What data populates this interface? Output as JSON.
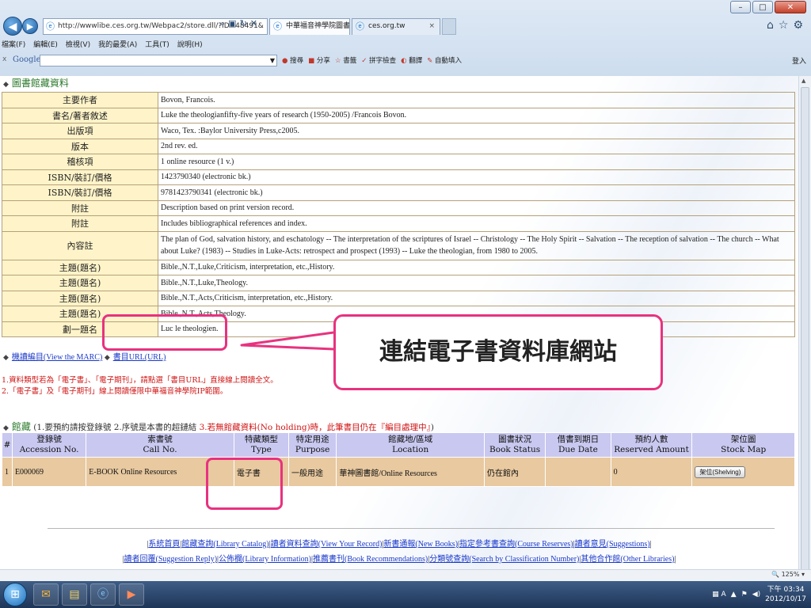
{
  "browser": {
    "address": "http://wwwlibe.ces.org.tw/Webpac2/store.dll/?ID=48491&",
    "tabs": [
      {
        "title": "中華福音神學院圖書館"
      },
      {
        "title": "ces.org.tw"
      }
    ],
    "menu": [
      "檔案(F)",
      "編輯(E)",
      "檢視(V)",
      "我的最愛(A)",
      "工具(T)",
      "說明(H)"
    ],
    "google": {
      "logo": "Google",
      "tools": [
        "搜尋",
        "分享",
        "書籤",
        "拼字檢查",
        "翻譯",
        "自動填入"
      ],
      "login": "登入"
    },
    "zoom": "125%"
  },
  "record": {
    "section_title": "圖書館藏資料",
    "fields": [
      {
        "label": "主要作者",
        "value": "Bovon, Francois."
      },
      {
        "label": "書名/著者敘述",
        "value": "Luke the theologianfifty-five years of research (1950-2005) /Francois Bovon."
      },
      {
        "label": "出版項",
        "value": "Waco, Tex. :Baylor University Press,c2005."
      },
      {
        "label": "版本",
        "value": "2nd rev. ed."
      },
      {
        "label": "稽核項",
        "value": "1 online resource (1 v.)"
      },
      {
        "label": "ISBN/裝訂/價格",
        "value": "1423790340 (electronic bk.)"
      },
      {
        "label": "ISBN/裝訂/價格",
        "value": "9781423790341 (electronic bk.)"
      },
      {
        "label": "附註",
        "value": "Description based on print version record."
      },
      {
        "label": "附註",
        "value": "Includes bibliographical references and index."
      },
      {
        "label": "內容註",
        "value": "The plan of God, salvation history, and eschatology -- The interpretation of the scriptures of Israel -- Christology -- The Holy Spirit -- Salvation -- The reception of salvation -- The church -- What about Luke? (1983) -- Studies in Luke-Acts: retrospect and prospect (1993) -- Luke the theologian, from 1980 to 2005."
      },
      {
        "label": "主題(題名)",
        "value": "Bible.,N.T.,Luke,Criticism, interpretation, etc.,History."
      },
      {
        "label": "主題(題名)",
        "value": "Bible.,N.T.,Luke,Theology."
      },
      {
        "label": "主題(題名)",
        "value": "Bible.,N.T.,Acts,Criticism, interpretation, etc.,History."
      },
      {
        "label": "主題(題名)",
        "value": "Bible.,N.T.,Acts,Theology."
      },
      {
        "label": "劃一題名",
        "value": "Luc le theologien."
      }
    ],
    "links": {
      "marc": "機讀編目(View the MARC)",
      "url": "書目URL(URL)"
    },
    "notes": [
      "1.資料類型若為「電子書」、「電子期刊」，請點選「書目URL」直接線上閱讀全文。",
      "2.「電子書」及「電子期刊」線上閱讀僅限中華福音神學院IP範圍。"
    ]
  },
  "callout": {
    "text": "連結電子書資料庫網站"
  },
  "holdings": {
    "title": "館藏",
    "instructions": "(1.要預約請按登錄號 2.序號是本書的超鏈結",
    "instructions_red": "3.若無館藏資料(No holding)時，此筆書目仍在『編目處理中』",
    "instructions_end": ")",
    "headers": [
      {
        "zh": "#",
        "en": ""
      },
      {
        "zh": "登錄號",
        "en": "Accession No."
      },
      {
        "zh": "索書號",
        "en": "Call No."
      },
      {
        "zh": "特藏類型",
        "en": "Type"
      },
      {
        "zh": "特定用途",
        "en": "Purpose"
      },
      {
        "zh": "館藏地/區域",
        "en": "Location"
      },
      {
        "zh": "圖書狀況",
        "en": "Book Status"
      },
      {
        "zh": "借書到期日",
        "en": "Due Date"
      },
      {
        "zh": "預約人數",
        "en": "Reserved Amount"
      },
      {
        "zh": "架位圖",
        "en": "Stock Map"
      }
    ],
    "rows": [
      {
        "num": "1",
        "accession": "E000069",
        "call_no": "E-BOOK Online Resources",
        "type": "電子書",
        "purpose": "一般用途",
        "location": "華神圖書館/Online Resources",
        "status": "仍在館內",
        "due": "",
        "reserved": "0",
        "stock_map": "架位(Shelving)"
      }
    ]
  },
  "footer": {
    "row1": [
      "系統首頁",
      "館藏查詢(Library Catalog)",
      "讀者資料查詢(View Your Record)",
      "新書通報(New Books)",
      "指定參考書查詢(Course Reserves)",
      "讀者意見(Suggestions)"
    ],
    "row2": [
      "讀者回覆(Suggestion Reply)",
      "公佈欄(Library Information)",
      "推薦書刊(Book Recommendations)",
      "分類號查詢(Search by Classification Number)",
      "其他合作館(Other Libraries)"
    ]
  },
  "taskbar": {
    "time": "下午 03:34",
    "date": "2012/10/17"
  }
}
